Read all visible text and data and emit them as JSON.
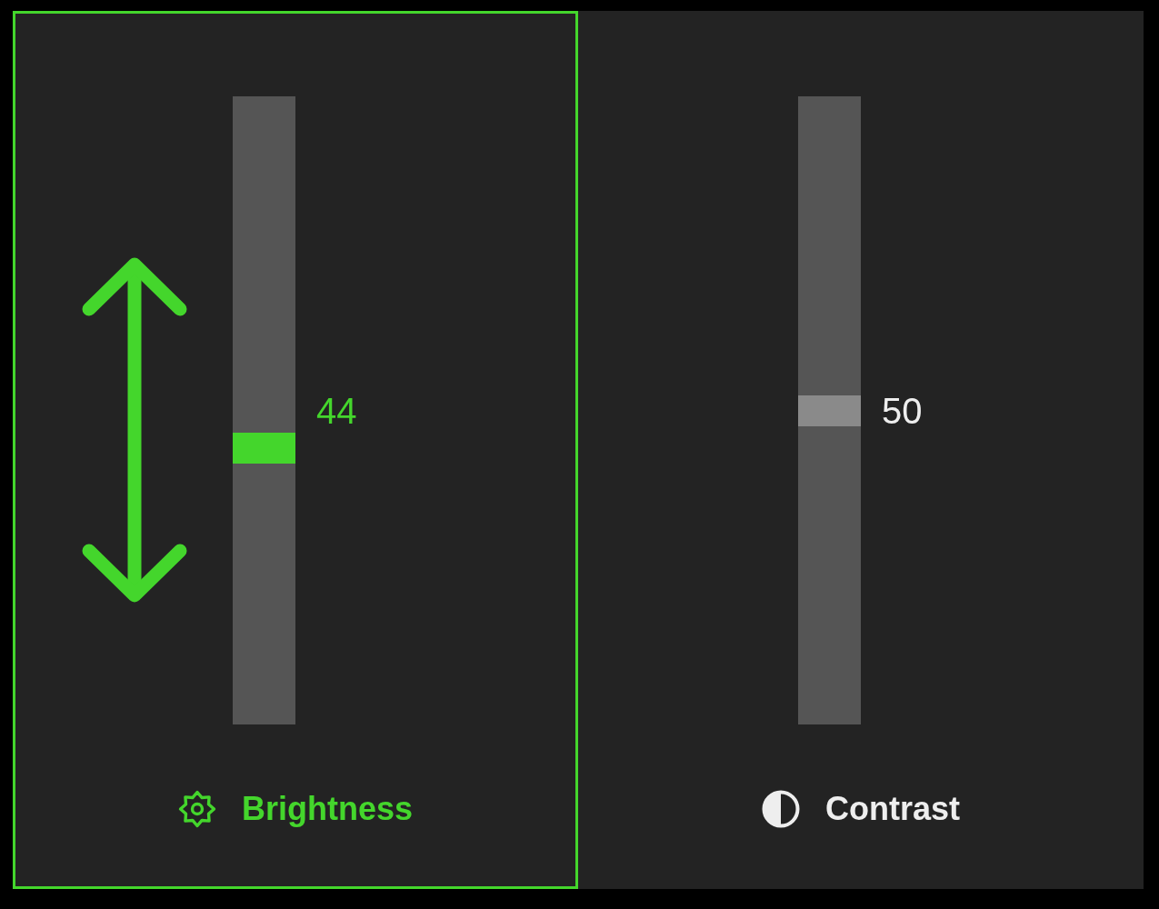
{
  "sliders": [
    {
      "label": "Brightness",
      "kind": "brightness",
      "selected": true,
      "level": 0.44,
      "value": "44"
    },
    {
      "label": "Contrast",
      "kind": "contrast",
      "selected": false,
      "level": 0.5,
      "value": "50"
    }
  ]
}
